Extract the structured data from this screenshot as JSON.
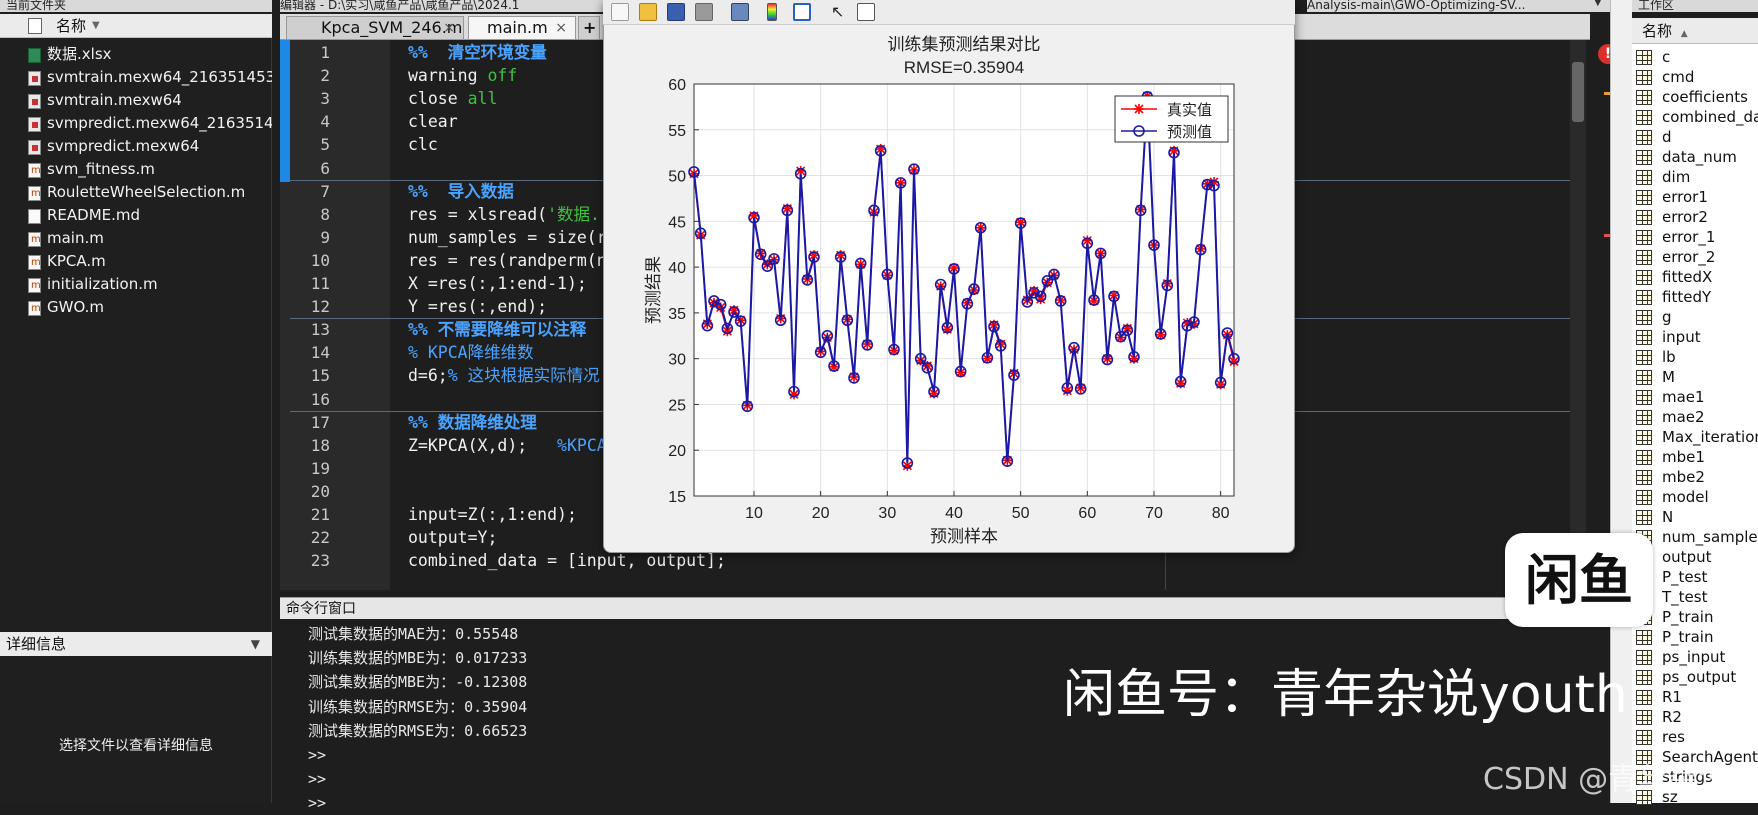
{
  "left_panel": {
    "title": "当前文件夹",
    "header": "名称",
    "files": [
      {
        "name": "数据.xlsx",
        "type": "xlsx"
      },
      {
        "name": "svmtrain.mexw64_216351453...",
        "type": "mex"
      },
      {
        "name": "svmtrain.mexw64",
        "type": "mex"
      },
      {
        "name": "svmpredict.mexw64_2163514...",
        "type": "mex"
      },
      {
        "name": "svmpredict.mexw64",
        "type": "mex"
      },
      {
        "name": "svm_fitness.m",
        "type": "m"
      },
      {
        "name": "RouletteWheelSelection.m",
        "type": "m"
      },
      {
        "name": "README.md",
        "type": "md"
      },
      {
        "name": "main.m",
        "type": "m"
      },
      {
        "name": "KPCA.m",
        "type": "m"
      },
      {
        "name": "initialization.m",
        "type": "m"
      },
      {
        "name": "GWO.m",
        "type": "m"
      }
    ],
    "details_header": "详细信息",
    "details_text": "选择文件以查看详细信息"
  },
  "editor": {
    "title": "编辑器 - D:\\实习\\咸鱼产品\\咸鱼产品\\2024.1",
    "title_right": "Analysis-main\\GWO-Optimizing-SV...",
    "tabs": [
      {
        "label": "Kpca_SVM_246.m",
        "close": "×"
      },
      {
        "label": "main.m",
        "close": "×"
      }
    ],
    "new_tab": "+",
    "line_numbers": [
      "1",
      "2",
      "3",
      "4",
      "5",
      "6",
      "7",
      "8",
      "9",
      "10",
      "11",
      "12",
      "13",
      "14",
      "15",
      "16",
      "17",
      "18",
      "19",
      "20",
      "21",
      "22",
      "23"
    ],
    "lines": [
      {
        "parts": [
          {
            "t": "%%  清空环境变量",
            "c": "comment"
          }
        ]
      },
      {
        "parts": [
          {
            "t": "warning ",
            "c": ""
          },
          {
            "t": "off",
            "c": "str"
          }
        ]
      },
      {
        "parts": [
          {
            "t": "close ",
            "c": ""
          },
          {
            "t": "all",
            "c": "str"
          }
        ]
      },
      {
        "parts": [
          {
            "t": "clear",
            "c": ""
          }
        ]
      },
      {
        "parts": [
          {
            "t": "clc",
            "c": ""
          }
        ]
      },
      {
        "parts": []
      },
      {
        "parts": [
          {
            "t": "%%  导入数据",
            "c": "comment"
          }
        ]
      },
      {
        "parts": [
          {
            "t": "res = xlsread(",
            "c": ""
          },
          {
            "t": "'数据.",
            "c": "str"
          }
        ]
      },
      {
        "parts": [
          {
            "t": "num_samples = size(r",
            "c": ""
          }
        ]
      },
      {
        "parts": [
          {
            "t": "res = res(randperm(n",
            "c": ""
          }
        ]
      },
      {
        "parts": [
          {
            "t": "X =res(:,1:end-1);",
            "c": ""
          }
        ]
      },
      {
        "parts": [
          {
            "t": "Y =res(:,end);",
            "c": ""
          }
        ]
      },
      {
        "parts": [
          {
            "t": "%% 不需要降维可以注释",
            "c": "comment"
          }
        ]
      },
      {
        "parts": [
          {
            "t": "% KPCA降维维数",
            "c": "comment-plain"
          }
        ]
      },
      {
        "parts": [
          {
            "t": "d=6;",
            "c": ""
          },
          {
            "t": "% 这块根据实际情况",
            "c": "comment-plain"
          }
        ]
      },
      {
        "parts": []
      },
      {
        "parts": [
          {
            "t": "%% 数据降维处理",
            "c": "comment"
          }
        ]
      },
      {
        "parts": [
          {
            "t": "Z=KPCA(X,d);   ",
            "c": ""
          },
          {
            "t": "%KPCA",
            "c": "comment-plain"
          }
        ]
      },
      {
        "parts": []
      },
      {
        "parts": []
      },
      {
        "parts": [
          {
            "t": "input=Z(:,1:end);",
            "c": ""
          }
        ]
      },
      {
        "parts": [
          {
            "t": "output=Y;",
            "c": ""
          }
        ]
      },
      {
        "parts": [
          {
            "t": "combined_data = [input, output];",
            "c": ""
          }
        ]
      }
    ]
  },
  "figure": {
    "toolbar_icons": [
      "new-figure-icon",
      "open-icon",
      "save-icon",
      "print-icon",
      "export-icon",
      "colorbar-icon",
      "legend-icon",
      "pointer-icon",
      "property-editor-icon"
    ]
  },
  "chart_data": {
    "type": "line",
    "title": "训练集预测结果对比",
    "subtitle": "RMSE=0.35904",
    "xlabel": "预测样本",
    "ylabel": "预测结果",
    "xlim": [
      1,
      82
    ],
    "ylim": [
      15,
      60
    ],
    "xticks": [
      10,
      20,
      30,
      40,
      50,
      60,
      70,
      80
    ],
    "yticks": [
      15,
      20,
      25,
      30,
      35,
      40,
      45,
      50,
      55,
      60
    ],
    "grid": true,
    "legend_position": "top-right",
    "series": [
      {
        "name": "真实值",
        "color": "#ff0000",
        "marker": "star",
        "values": [
          50.2,
          43.5,
          33.8,
          36.1,
          35.6,
          33.0,
          35.3,
          34.2,
          24.9,
          45.6,
          41.5,
          40.3,
          40.8,
          34.4,
          46.4,
          26.1,
          50.5,
          38.7,
          41.3,
          30.8,
          32.3,
          29.1,
          41.3,
          34.3,
          28.0,
          40.3,
          31.6,
          46.0,
          52.9,
          39.1,
          30.9,
          49.2,
          18.3,
          50.6,
          29.8,
          29.2,
          26.2,
          37.9,
          33.2,
          39.9,
          28.5,
          36.1,
          37.5,
          44.3,
          30.0,
          33.7,
          31.6,
          18.9,
          28.4,
          44.9,
          36.4,
          37.4,
          36.5,
          38.3,
          39.1,
          36.4,
          26.5,
          31.0,
          26.8,
          42.9,
          36.3,
          41.5,
          30.0,
          36.9,
          32.3,
          33.3,
          30.0,
          46.3,
          58.7,
          42.4,
          32.6,
          38.2,
          52.7,
          27.3,
          33.9,
          33.8,
          42.0,
          49.1,
          49.3,
          27.2,
          32.6,
          29.7
        ]
      },
      {
        "name": "预测值",
        "color": "#1a1aa6",
        "marker": "circle",
        "values": [
          50.4,
          43.7,
          33.6,
          36.3,
          35.9,
          33.3,
          35.1,
          34.1,
          24.8,
          45.4,
          41.4,
          40.1,
          40.9,
          34.2,
          46.2,
          26.4,
          50.2,
          38.6,
          41.1,
          30.7,
          32.5,
          29.2,
          41.1,
          34.2,
          27.9,
          40.4,
          31.5,
          46.2,
          52.7,
          39.2,
          31.0,
          49.2,
          18.6,
          50.7,
          30.0,
          29.0,
          26.4,
          38.1,
          33.4,
          39.8,
          28.6,
          36.0,
          37.6,
          44.3,
          30.1,
          33.5,
          31.4,
          18.8,
          28.2,
          44.8,
          36.2,
          37.2,
          36.8,
          38.5,
          39.2,
          36.3,
          26.8,
          31.2,
          26.7,
          42.6,
          36.4,
          41.5,
          29.9,
          36.8,
          32.4,
          33.1,
          30.2,
          46.2,
          58.6,
          42.4,
          32.7,
          38.0,
          52.5,
          27.5,
          33.6,
          34.0,
          41.9,
          49.0,
          48.9,
          27.4,
          32.8,
          30.0
        ]
      }
    ]
  },
  "command_window": {
    "header": "命令行窗口",
    "lines": [
      "测试集数据的MAE为：0.55548",
      "训练集数据的MBE为：0.017233",
      "测试集数据的MBE为：-0.12308",
      "训练集数据的RMSE为：0.35904",
      "测试集数据的RMSE为：0.66523",
      ">>",
      ">>",
      ">>"
    ]
  },
  "workspace": {
    "title": "工作区",
    "header": "名称",
    "sort_arrow": "▲",
    "variables": [
      "c",
      "cmd",
      "coefficients",
      "combined_da",
      "d",
      "data_num",
      "dim",
      "error1",
      "error2",
      "error_1",
      "error_2",
      "fittedX",
      "fittedY",
      "g",
      "input",
      "lb",
      "M",
      "mae1",
      "mae2",
      "Max_iteration",
      "mbe1",
      "mbe2",
      "model",
      "N",
      "num_samples",
      "output",
      "P_test",
      "T_test",
      "P_train",
      "P_train",
      "ps_input",
      "ps_output",
      "R1",
      "R2",
      "res",
      "SearchAgent",
      "strings",
      "sz"
    ]
  },
  "overlays": {
    "logo_text": "闲鱼",
    "watermark": "闲鱼号：青年杂说youth",
    "csdn": "CSDN @青年杂说"
  }
}
